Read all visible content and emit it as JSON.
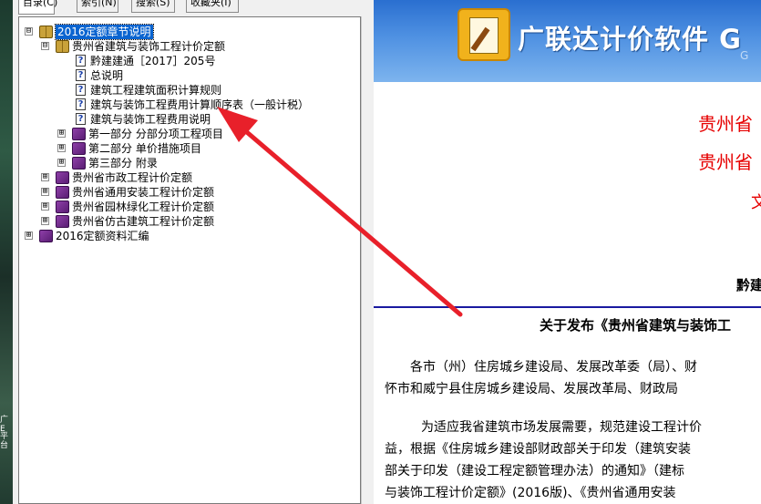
{
  "desktop": {
    "text1": "广E",
    "text2": "平台"
  },
  "tabs": [
    {
      "label": "目录(C)"
    },
    {
      "label": "索引(N)"
    },
    {
      "label": "搜索(S)"
    },
    {
      "label": "收藏夹(I)"
    }
  ],
  "tree": {
    "items": [
      {
        "label": "2016定额章节说明",
        "icon": "book-open-icon",
        "expander": "⊟",
        "selected": true
      },
      {
        "label": "贵州省建筑与装饰工程计价定额",
        "icon": "book-open-icon",
        "expander": "⊟"
      },
      {
        "label": "黔建建通［2017］205号",
        "icon": "help-page-icon"
      },
      {
        "label": "总说明",
        "icon": "help-page-icon"
      },
      {
        "label": "建筑工程建筑面积计算规则",
        "icon": "help-page-icon"
      },
      {
        "label": "建筑与装饰工程费用计算顺序表（一般计税）",
        "icon": "help-page-icon"
      },
      {
        "label": "建筑与装饰工程费用说明",
        "icon": "help-page-icon"
      },
      {
        "label": "第一部分 分部分项工程项目",
        "icon": "book-closed-icon",
        "expander": "⊞"
      },
      {
        "label": "第二部分 单价措施项目",
        "icon": "book-closed-icon",
        "expander": "⊞"
      },
      {
        "label": "第三部分 附录",
        "icon": "book-closed-icon",
        "expander": "⊞"
      },
      {
        "label": "贵州省市政工程计价定额",
        "icon": "book-closed-icon",
        "expander": "⊞"
      },
      {
        "label": "贵州省通用安装工程计价定额",
        "icon": "book-closed-icon",
        "expander": "⊞"
      },
      {
        "label": "贵州省园林绿化工程计价定额",
        "icon": "book-closed-icon",
        "expander": "⊞"
      },
      {
        "label": "贵州省仿古建筑工程计价定额",
        "icon": "book-closed-icon",
        "expander": "⊞"
      },
      {
        "label": "2016定额资料汇编",
        "icon": "book-closed-icon",
        "expander": "⊞"
      }
    ]
  },
  "content": {
    "banner_title": "广联达计价软件 G",
    "banner_sub": "G",
    "red_line1": "贵州省",
    "red_line2": "贵州省",
    "red_fragment": "文",
    "doc_number_fragment": "黔建",
    "heading": "关于发布《贵州省建筑与装饰工",
    "para1_line1": "各市（州）住房城乡建设局、发展改革委（局）、财",
    "para1_line2": "怀市和威宁县住房城乡建设局、发展改革局、财政局",
    "para2_line1": "为适应我省建筑市场发展需要，规范建设工程计价",
    "para2_line2": "益，根据《住房城乡建设部财政部关于印发（建筑安装",
    "para2_line3": "部关于印发（建设工程定额管理办法）的通知》（建标",
    "para2_line4": "与装饰工程计价定额》(2016版)、《贵州省通用安装"
  },
  "colors": {
    "selection": "#0a64d0",
    "red_text": "#e60000",
    "arrow": "#e8202a",
    "rule": "#1a1aa0"
  }
}
